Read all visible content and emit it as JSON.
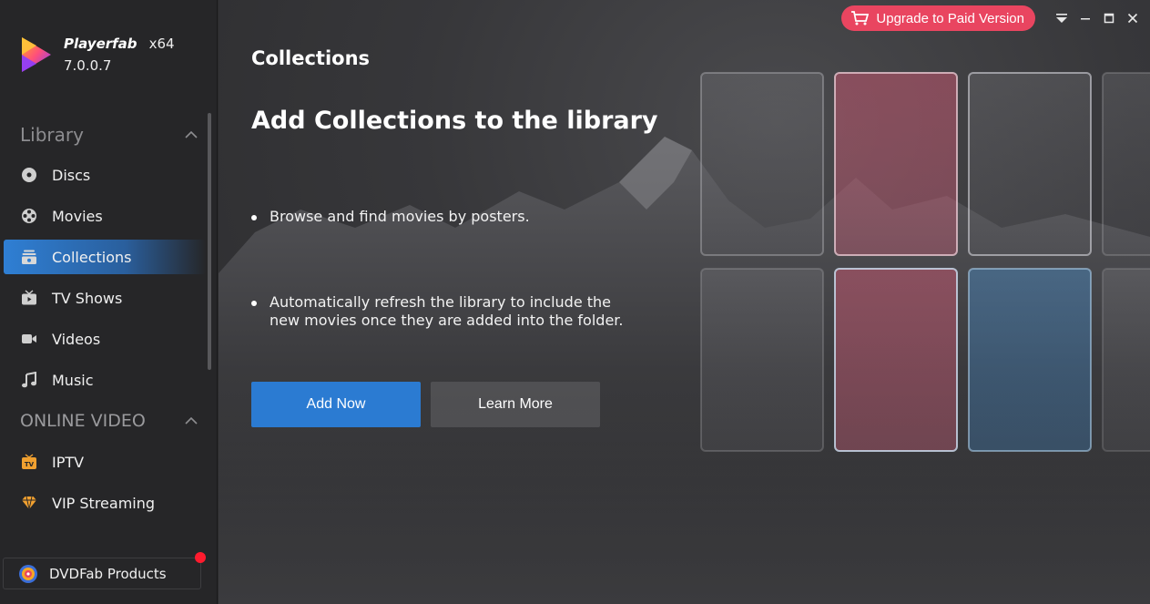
{
  "app": {
    "name": "Playerfab",
    "arch": "x64",
    "version": "7.0.0.7"
  },
  "sidebar": {
    "library_title": "Library",
    "library_items": [
      {
        "label": "Discs",
        "icon": "disc-icon"
      },
      {
        "label": "Movies",
        "icon": "film-reel-icon"
      },
      {
        "label": "Collections",
        "icon": "collections-icon",
        "active": true
      },
      {
        "label": "TV Shows",
        "icon": "tv-icon"
      },
      {
        "label": "Videos",
        "icon": "video-camera-icon"
      },
      {
        "label": "Music",
        "icon": "music-note-icon"
      }
    ],
    "online_title": "ONLINE VIDEO",
    "online_items": [
      {
        "label": "IPTV",
        "icon": "iptv-icon"
      },
      {
        "label": "VIP Streaming",
        "icon": "diamond-icon"
      }
    ],
    "products_label": "DVDFab Products"
  },
  "topbar": {
    "upgrade_label": "Upgrade to Paid Version"
  },
  "main": {
    "page_title": "Collections",
    "headline": "Add Collections to the library",
    "bullets": [
      "Browse and find movies by posters.",
      "Automatically refresh the library to include the",
      "new movies once they are added into the folder."
    ],
    "add_button": "Add Now",
    "learn_button": "Learn More"
  },
  "colors": {
    "accent": "#2b7bd2",
    "upgrade": "#e94560",
    "notification": "#ff1b2e"
  }
}
